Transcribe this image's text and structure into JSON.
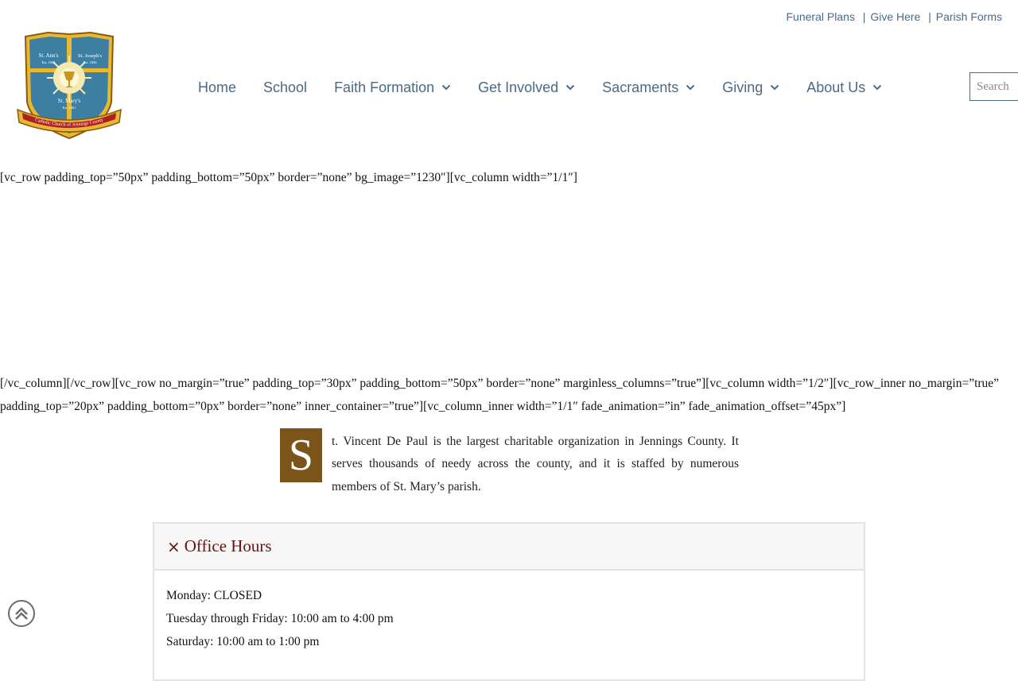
{
  "top_links": {
    "items": [
      {
        "label": "Funeral Plans"
      },
      {
        "label": "Give Here"
      },
      {
        "label": "Parish Forms"
      }
    ],
    "separator": "|"
  },
  "logo": {
    "left_text": "St. Ann's",
    "left_est": "Est. 1841",
    "right_text": "St. Joseph's",
    "right_est": "Est. 1836",
    "center_text": "St. Mary's",
    "center_est": "Est. 1861",
    "banner_text": "Catholic Church of Jennings County",
    "colors": {
      "shield": "#3d7fa3",
      "gold": "#e8b830",
      "red": "#b02020"
    }
  },
  "nav": {
    "items": [
      {
        "label": "Home",
        "has_dropdown": false
      },
      {
        "label": "School",
        "has_dropdown": false
      },
      {
        "label": "Faith Formation",
        "has_dropdown": true
      },
      {
        "label": "Get Involved",
        "has_dropdown": true
      },
      {
        "label": "Sacraments",
        "has_dropdown": true
      },
      {
        "label": "Giving",
        "has_dropdown": true
      },
      {
        "label": "About Us",
        "has_dropdown": true
      }
    ],
    "search_placeholder": "Search"
  },
  "content": {
    "shortcode_1": "[vc_row padding_top=”50px” padding_bottom=”50px” border=”none” bg_image=”1230″][vc_column width=”1/1″]",
    "shortcode_2": "[/vc_column][/vc_row][vc_row no_margin=”true” padding_top=”30px” padding_bottom=”50px” border=”none” marginless_columns=”true”][vc_column width=”1/2″][vc_row_inner no_margin=”true”",
    "shortcode_3": "padding_top=”20px” padding_bottom=”0px” border=”none” inner_container=”true”][vc_column_inner width=”1/1″ fade_animation=”in” fade_animation_offset=”45px”]",
    "dropcap_letter": "S",
    "intro_text": "t. Vincent De Paul is the largest charitable organization in Jennings County. It serves thousands of needy across the county, and it is staffed by numerous members of St. Mary’s parish."
  },
  "office_hours": {
    "toggle_icon": "×",
    "title": "Office Hours",
    "lines": [
      "Monday: CLOSED",
      "Tuesday through Friday: 10:00 am to 4:00 pm",
      "Saturday: 10:00 am to 1:00 pm"
    ]
  },
  "colors": {
    "link": "#4a6a86",
    "dropcap_bg": "#7a5418",
    "accordion_title": "#6b1010"
  },
  "icons": {
    "nav_dropdown": "chevron-down-icon",
    "scroll_top": "chevron-up-circle-icon"
  }
}
